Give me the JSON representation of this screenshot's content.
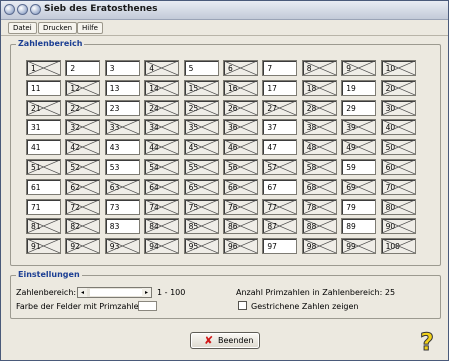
{
  "window": {
    "title": "Sieb des Eratosthenes"
  },
  "menu": [
    "Datei",
    "Drucken",
    "Hilfe"
  ],
  "range_group": {
    "legend": "Zahlenbereich"
  },
  "grid": {
    "numbers": [
      1,
      2,
      3,
      4,
      5,
      6,
      7,
      8,
      9,
      10,
      11,
      12,
      13,
      14,
      15,
      16,
      17,
      18,
      19,
      20,
      21,
      22,
      23,
      24,
      25,
      26,
      27,
      28,
      29,
      30,
      31,
      32,
      33,
      34,
      35,
      36,
      37,
      38,
      39,
      40,
      41,
      42,
      43,
      44,
      45,
      46,
      47,
      48,
      49,
      50,
      51,
      52,
      53,
      54,
      55,
      56,
      57,
      58,
      59,
      60,
      61,
      62,
      63,
      64,
      65,
      66,
      67,
      68,
      69,
      70,
      71,
      72,
      73,
      74,
      75,
      76,
      77,
      78,
      79,
      80,
      81,
      82,
      83,
      84,
      85,
      86,
      87,
      88,
      89,
      90,
      91,
      92,
      93,
      94,
      95,
      96,
      97,
      98,
      99,
      100
    ],
    "crossed": [
      1,
      4,
      6,
      8,
      9,
      10,
      12,
      14,
      15,
      16,
      18,
      20,
      21,
      22,
      24,
      25,
      26,
      27,
      28,
      30,
      32,
      33,
      34,
      35,
      36,
      38,
      39,
      40,
      42,
      44,
      45,
      46,
      48,
      49,
      50,
      51,
      52,
      54,
      55,
      56,
      57,
      58,
      60,
      62,
      63,
      64,
      65,
      66,
      68,
      69,
      70,
      72,
      74,
      75,
      76,
      77,
      78,
      80,
      81,
      82,
      84,
      85,
      86,
      87,
      88,
      90,
      91,
      92,
      93,
      94,
      95,
      96,
      98,
      99,
      100
    ]
  },
  "settings": {
    "legend": "Einstellungen",
    "range_label": "Zahlenbereich:",
    "range_value": "1 - 100",
    "color_label": "Farbe der Felder mit Primzahlen:",
    "prime_count_label": "Anzahl Primzahlen in Zahlenbereich: 25",
    "crossed_label": "Gestrichene Zahlen zeigen",
    "scroll_left": "◂",
    "scroll_right": "▸"
  },
  "buttons": {
    "quit_label": "Beenden",
    "quit_icon": "✘",
    "help_icon": "?"
  }
}
